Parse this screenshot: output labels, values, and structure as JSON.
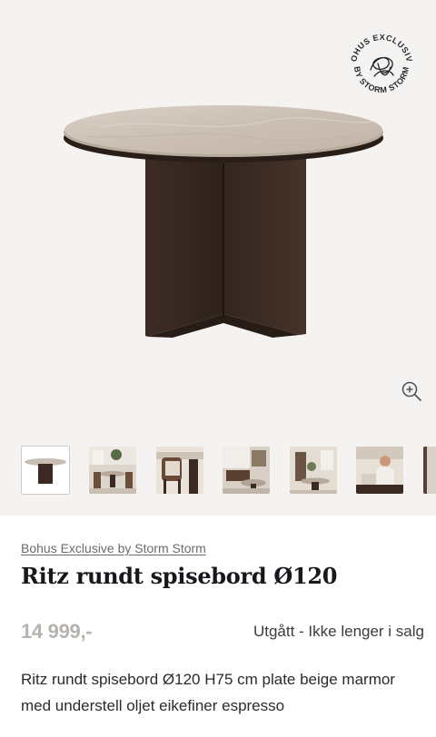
{
  "gallery": {
    "badge": {
      "top_text": "BOHUS EXCLUSIVE",
      "bottom_text": "BY STORM STORM",
      "icon": "signature-logo-icon"
    },
    "zoom": {
      "icon": "zoom-in-icon"
    },
    "thumbnails": [
      {
        "icon": "table-product-thumb",
        "active": true
      },
      {
        "icon": "dining-room-thumb"
      },
      {
        "icon": "chair-closeup-thumb"
      },
      {
        "icon": "interior-thumb"
      },
      {
        "icon": "living-room-thumb"
      },
      {
        "icon": "person-seated-thumb"
      },
      {
        "icon": "partial-thumb"
      }
    ]
  },
  "product": {
    "brand": "Bohus Exclusive by Storm Storm",
    "title": "Ritz rundt spisebord Ø120",
    "price": "14 999,-",
    "status": "Utgått - Ikke lenger i salg",
    "description": "Ritz rundt spisebord Ø120 H75 cm plate beige marmor med understell oljet eikefiner espresso"
  },
  "colors": {
    "gallery_bg": "#f5f3f1",
    "marble": "#cfc3b8",
    "wood": "#3a2a22",
    "price_muted": "#b6b3af"
  }
}
